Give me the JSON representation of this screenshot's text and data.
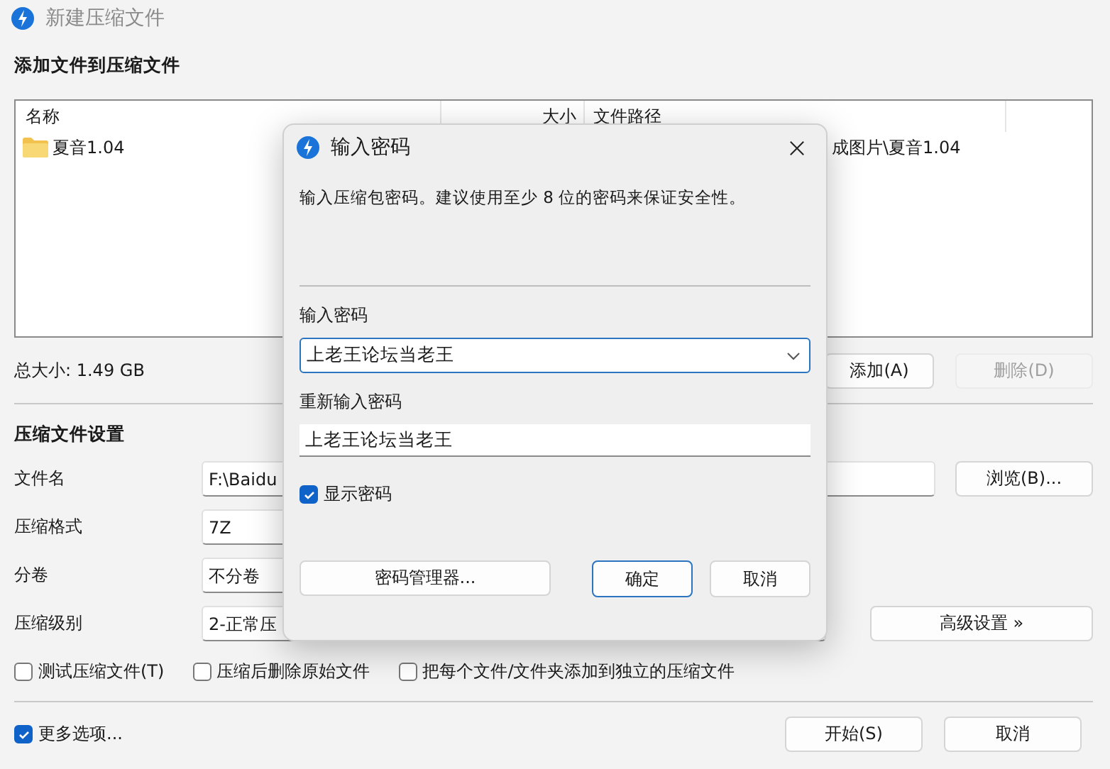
{
  "window": {
    "title": "新建压缩文件",
    "active": false
  },
  "files_section": {
    "heading": "添加文件到压缩文件",
    "columns": [
      "名称",
      "大小",
      "文件路径"
    ],
    "rows": [
      {
        "name": "夏音1.04",
        "path": "成图片\\夏音1.04"
      }
    ],
    "total_size": "总大小: 1.49 GB",
    "buttons": [
      {
        "label": "添加(A)",
        "disabled": false
      },
      {
        "label": "删除(D)",
        "disabled": true
      }
    ]
  },
  "settings": {
    "heading": "压缩文件设置",
    "fields": [
      {
        "label": "文件名",
        "value": "F:\\Baidu"
      },
      {
        "label": "压缩格式",
        "value": "7Z"
      },
      {
        "label": "分卷",
        "value": "不分卷"
      },
      {
        "label": "压缩级别",
        "value": "2-正常压"
      }
    ],
    "browse_button": "浏览(B)...",
    "advanced_button": "高级设置 »",
    "options": [
      {
        "label": "测试压缩文件(T)",
        "checked": false
      },
      {
        "label": "压缩后删除原始文件",
        "checked": false
      },
      {
        "label": "把每个文件/文件夹添加到独立的压缩文件",
        "checked": false
      }
    ]
  },
  "more_options": {
    "label": "更多选项...",
    "checked": true
  },
  "buttons": [
    "开始(S)",
    "取消"
  ],
  "dialog": {
    "title": "输入密码",
    "description": "输入压缩包密码。建议使用至少 8 位的密码来保证安全性。",
    "password_label": "输入密码",
    "password": "上老王论坛当老王",
    "confirm_label": "重新输入密码",
    "confirm": "上老王论坛当老王",
    "show_password": {
      "label": "显示密码",
      "checked": true
    },
    "manager_button": "密码管理器...",
    "ok_button": "确定",
    "cancel_button": "取消"
  }
}
